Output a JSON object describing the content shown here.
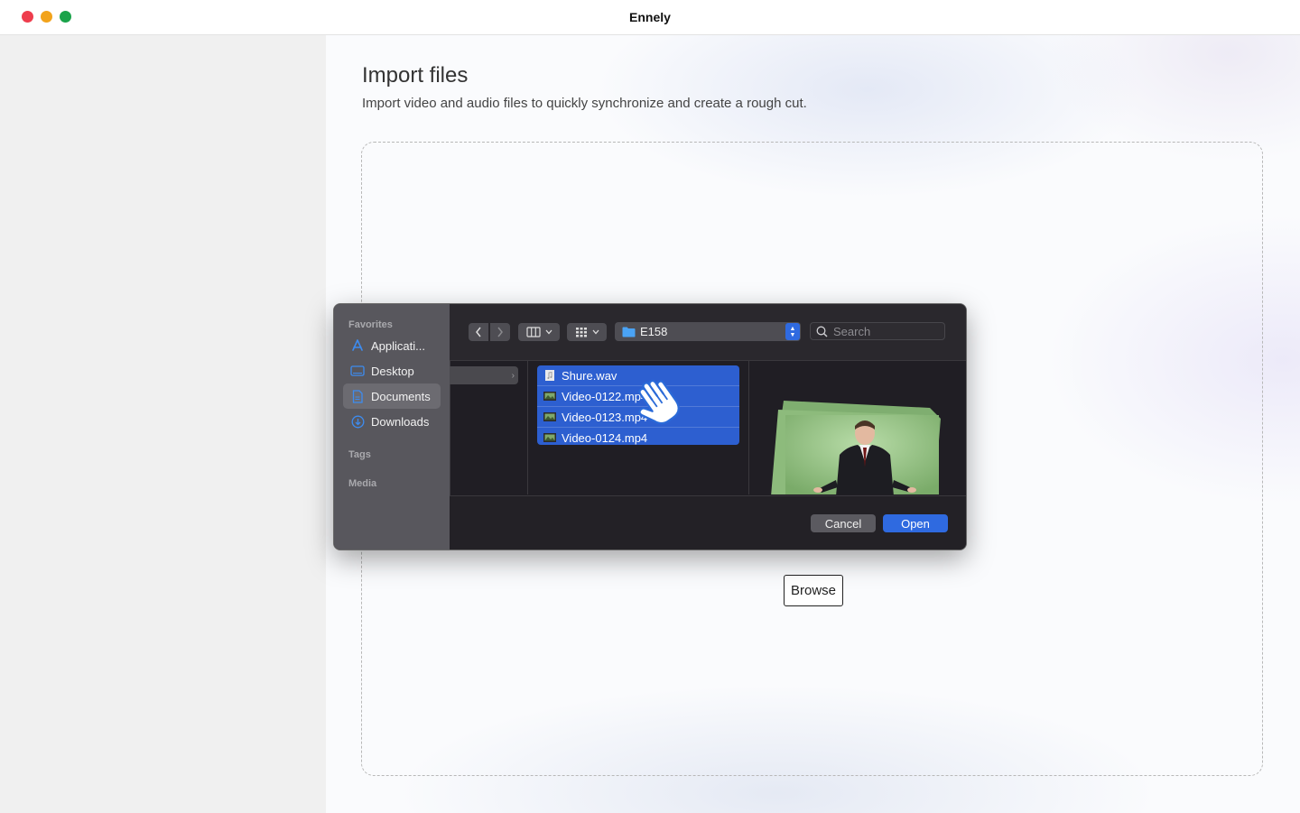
{
  "window": {
    "title": "Ennely"
  },
  "page": {
    "title": "Import files",
    "subtitle": "Import video and audio files to quickly synchronize and create a rough cut.",
    "browse_label": "Browse"
  },
  "dialog": {
    "sidebar": {
      "favorites_heading": "Favorites",
      "items": [
        {
          "label": "Applicati...",
          "icon": "app-store-icon"
        },
        {
          "label": "Desktop",
          "icon": "desktop-icon"
        },
        {
          "label": "Documents",
          "icon": "document-icon",
          "selected": true
        },
        {
          "label": "Downloads",
          "icon": "download-icon"
        }
      ],
      "tags_heading": "Tags",
      "media_heading": "Media"
    },
    "toolbar": {
      "folder": "E158",
      "search_placeholder": "Search"
    },
    "files": [
      {
        "name": "Shure.wav",
        "icon": "audio-file-icon"
      },
      {
        "name": "Video-0122.mp4",
        "icon": "video-file-icon"
      },
      {
        "name": "Video-0123.mp4",
        "icon": "video-file-icon"
      },
      {
        "name": "Video-0124.mp4",
        "icon": "video-file-icon"
      }
    ],
    "cancel_label": "Cancel",
    "open_label": "Open"
  },
  "colors": {
    "accent": "#2f6ae0",
    "selection": "#2d5fd0",
    "close": "#ee3d4d",
    "minimize": "#f2a31b",
    "zoom": "#1aa34a"
  }
}
